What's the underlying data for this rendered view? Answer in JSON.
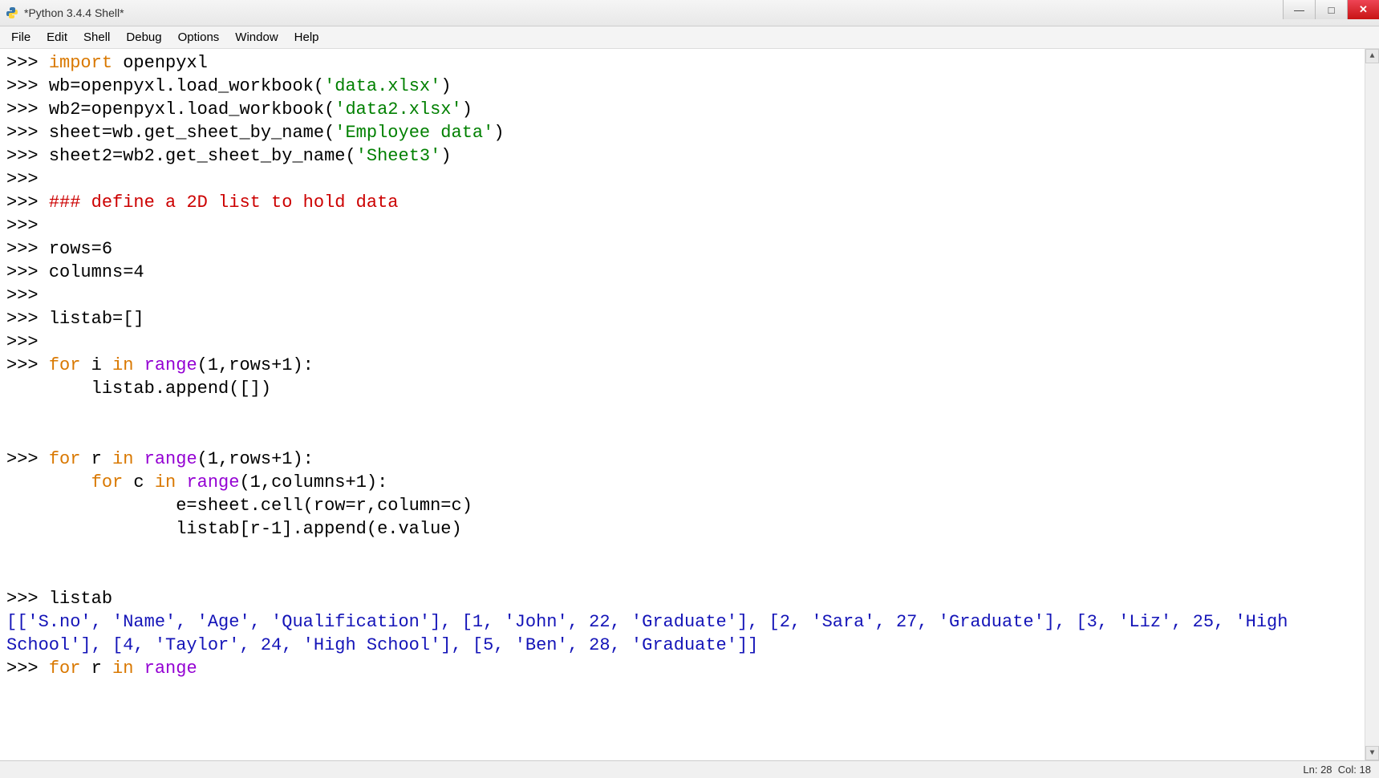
{
  "window": {
    "title": "*Python 3.4.4 Shell*"
  },
  "menu": {
    "items": [
      "File",
      "Edit",
      "Shell",
      "Debug",
      "Options",
      "Window",
      "Help"
    ]
  },
  "status": {
    "ln_label": "Ln:",
    "ln": "28",
    "col_label": "Col:",
    "col": "18"
  },
  "code": {
    "prompt": ">>> ",
    "l1_kw": "import",
    "l1_rest": " openpyxl",
    "l2": "wb=openpyxl.load_workbook(",
    "l2_str": "'data.xlsx'",
    "l2_end": ")",
    "l3": "wb2=openpyxl.load_workbook(",
    "l3_str": "'data2.xlsx'",
    "l3_end": ")",
    "l4": "sheet=wb.get_sheet_by_name(",
    "l4_str": "'Employee data'",
    "l4_end": ")",
    "l5": "sheet2=wb2.get_sheet_by_name(",
    "l5_str": "'Sheet3'",
    "l5_end": ")",
    "comment": "### define a 2D list to hold data",
    "rows": "rows=6",
    "cols": "columns=4",
    "listab_init": "listab=[]",
    "for1_for": "for",
    "for1_i": " i ",
    "for1_in": "in",
    "for1_sp": " ",
    "for1_range": "range",
    "for1_args": "(1,rows+1):",
    "for1_body": "        listab.append([])",
    "for2_for": "for",
    "for2_r": " r ",
    "for2_in": "in",
    "for2_range": "range",
    "for2_args": "(1,rows+1):",
    "for2_inner_indent": "        ",
    "for2_inner_for": "for",
    "for2_inner_c": " c ",
    "for2_inner_in": "in",
    "for2_inner_range": "range",
    "for2_inner_args": "(1,columns+1):",
    "for2_body1": "                e=sheet.cell(row=r,column=c)",
    "for2_body2": "                listab[r-1].append(e.value)",
    "listab_call": "listab",
    "output": "[['S.no', 'Name', 'Age', 'Qualification'], [1, 'John', 22, 'Graduate'], [2, 'Sara', 27, 'Graduate'], [3, 'Liz', 25, 'High School'], [4, 'Taylor', 24, 'High School'], [5, 'Ben', 28, 'Graduate']]",
    "last_for": "for",
    "last_r": " r ",
    "last_in": "in",
    "last_range": "range"
  }
}
